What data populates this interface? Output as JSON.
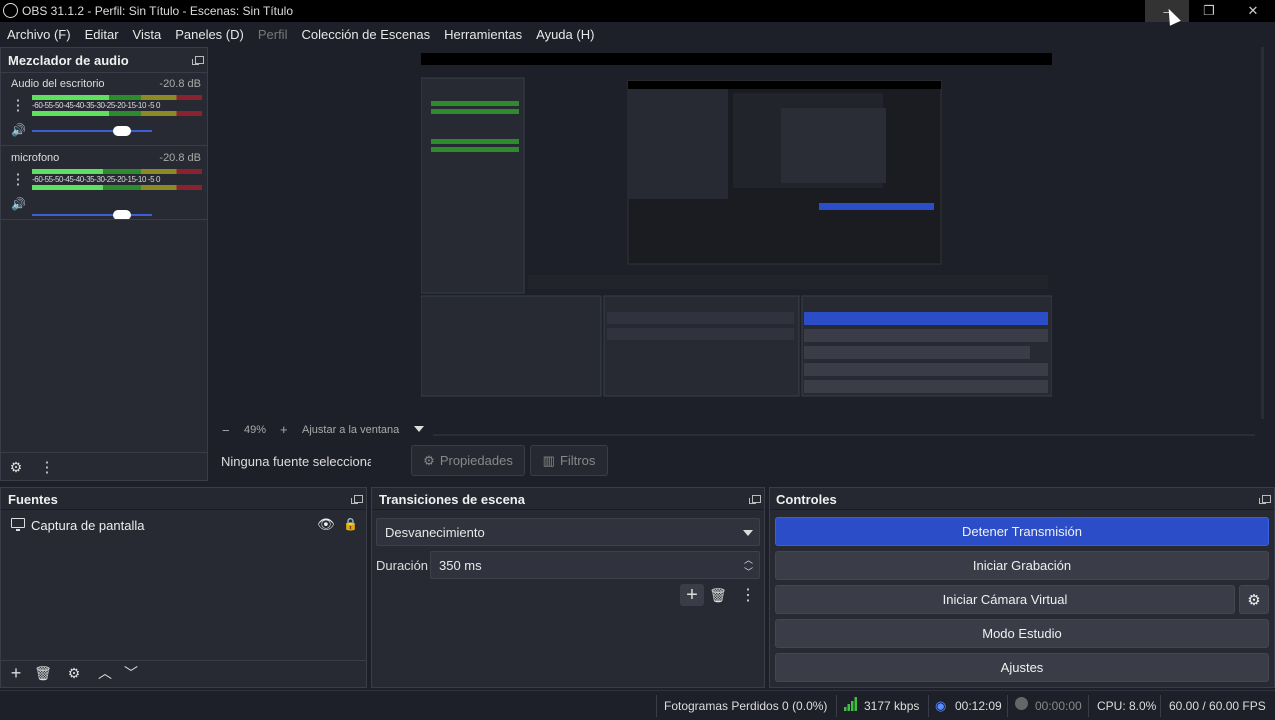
{
  "window": {
    "title": "OBS 31.1.2 - Perfil: Sin Título - Escenas: Sin Título",
    "minimize": "–",
    "restore": "❐",
    "close": "✕"
  },
  "menu": [
    "Archivo (F)",
    "Editar",
    "Vista",
    "Paneles (D)",
    "Perfil",
    "Colección de Escenas",
    "Herramientas",
    "Ayuda (H)"
  ],
  "mixer": {
    "title": "Mezclador de audio",
    "scale": "-60-55-50-45-40-35-30-25-20-15-10 -5  0",
    "channels": [
      {
        "name": "Audio del escritorio",
        "db": "-20.8 dB",
        "level": 0.45,
        "volume": 0.75
      },
      {
        "name": "microfono",
        "db": "-20.8 dB",
        "level": 0.42,
        "volume": 0.75
      }
    ]
  },
  "zoom": {
    "minus": "−",
    "value": "49%",
    "plus": "+",
    "fit": "Ajustar a la ventana"
  },
  "selection": {
    "none": "Ninguna fuente seleccionada",
    "properties": "Propiedades",
    "filters": "Filtros"
  },
  "sources": {
    "title": "Fuentes",
    "items": [
      {
        "name": "Captura de pantalla"
      }
    ]
  },
  "transitions": {
    "title": "Transiciones de escena",
    "selected": "Desvanecimiento",
    "duration_label": "Duración",
    "duration_value": "350 ms"
  },
  "controls": {
    "title": "Controles",
    "stop_stream": "Detener Transmisión",
    "start_record": "Iniciar Grabación",
    "start_virtual_cam": "Iniciar Cámara Virtual",
    "studio_mode": "Modo Estudio",
    "settings": "Ajustes"
  },
  "status": {
    "dropped_frames": "Fotogramas Perdidos 0 (0.0%)",
    "bitrate": "3177 kbps",
    "stream_time": "00:12:09",
    "record_time": "00:00:00",
    "cpu": "CPU: 8.0%",
    "fps": "60.00 / 60.00 FPS"
  },
  "colors": {
    "accent": "#2b4ec8",
    "meter_green": "#5fe05f"
  }
}
